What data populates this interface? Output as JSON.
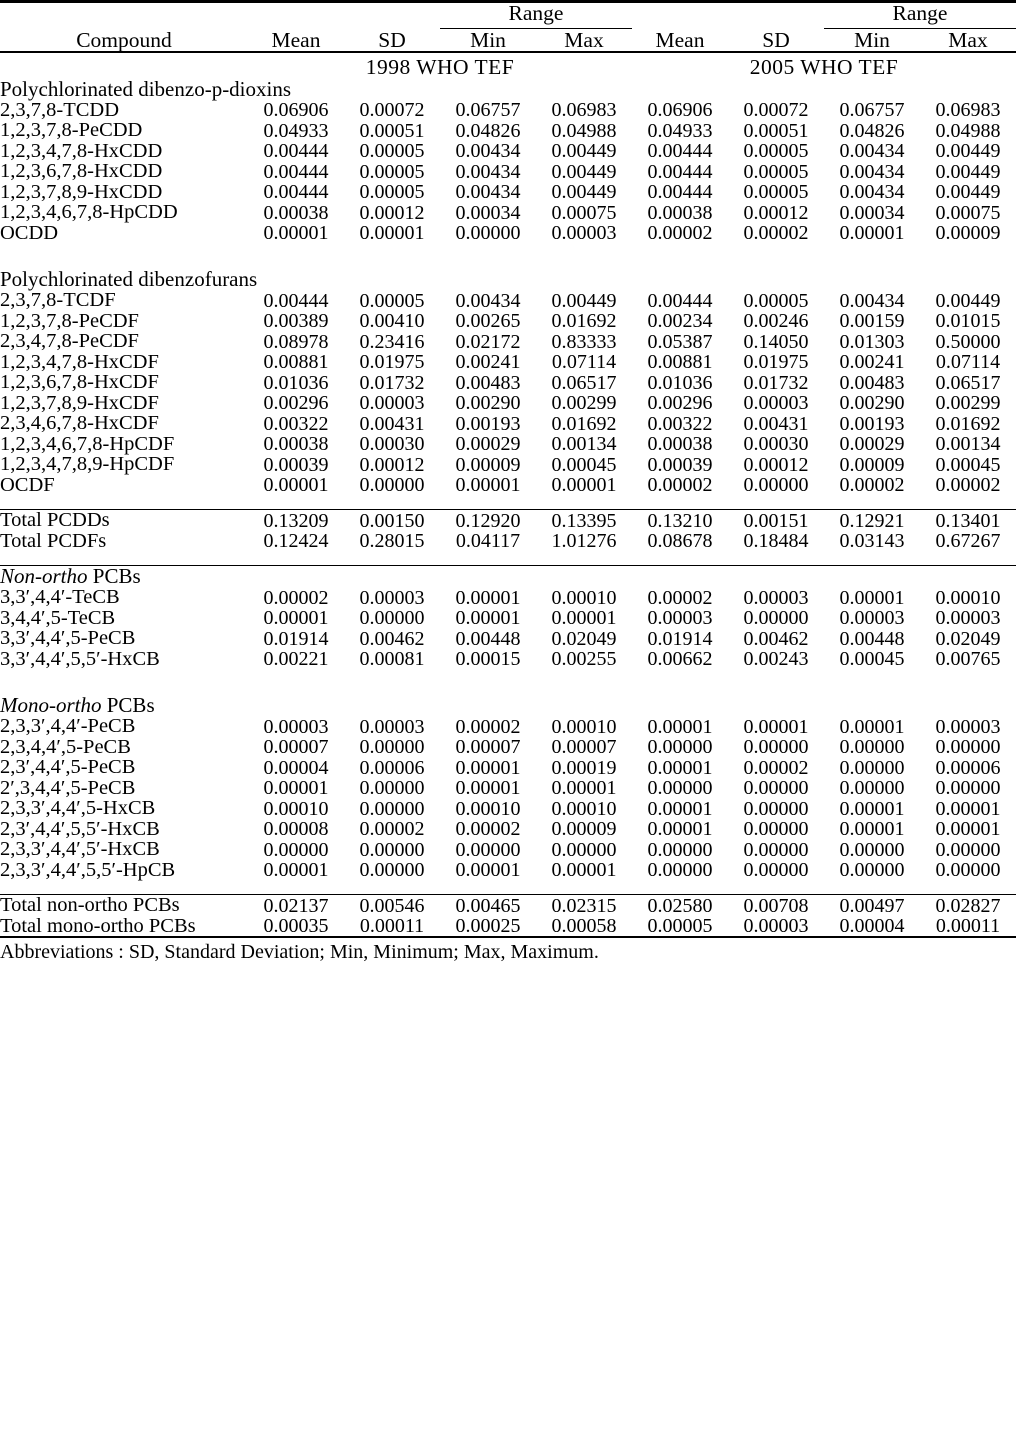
{
  "table": {
    "header": {
      "compound_label": "Compound",
      "mean_label": "Mean",
      "sd_label": "SD",
      "range_label": "Range",
      "min_label": "Min",
      "max_label": "Max"
    },
    "group_headers": {
      "tef_1998": "1998  WHO  TEF",
      "tef_2005": "2005  WHO  TEF"
    },
    "sections": [
      {
        "id": "pcdd",
        "title": "Polychlorinated dibenzo-p-dioxins",
        "title_style": "plain-italic-p",
        "rows": [
          {
            "compound": "2,3,7,8-TCDD",
            "v": [
              "0.06906",
              "0.00072",
              "0.06757",
              "0.06983",
              "0.06906",
              "0.00072",
              "0.06757",
              "0.06983"
            ]
          },
          {
            "compound": "1,2,3,7,8-PeCDD",
            "v": [
              "0.04933",
              "0.00051",
              "0.04826",
              "0.04988",
              "0.04933",
              "0.00051",
              "0.04826",
              "0.04988"
            ]
          },
          {
            "compound": "1,2,3,4,7,8-HxCDD",
            "v": [
              "0.00444",
              "0.00005",
              "0.00434",
              "0.00449",
              "0.00444",
              "0.00005",
              "0.00434",
              "0.00449"
            ]
          },
          {
            "compound": "1,2,3,6,7,8-HxCDD",
            "v": [
              "0.00444",
              "0.00005",
              "0.00434",
              "0.00449",
              "0.00444",
              "0.00005",
              "0.00434",
              "0.00449"
            ]
          },
          {
            "compound": "1,2,3,7,8,9-HxCDD",
            "v": [
              "0.00444",
              "0.00005",
              "0.00434",
              "0.00449",
              "0.00444",
              "0.00005",
              "0.00434",
              "0.00449"
            ]
          },
          {
            "compound": "1,2,3,4,6,7,8-HpCDD",
            "v": [
              "0.00038",
              "0.00012",
              "0.00034",
              "0.00075",
              "0.00038",
              "0.00012",
              "0.00034",
              "0.00075"
            ]
          },
          {
            "compound": "OCDD",
            "v": [
              "0.00001",
              "0.00001",
              "0.00000",
              "0.00003",
              "0.00002",
              "0.00002",
              "0.00001",
              "0.00009"
            ]
          }
        ]
      },
      {
        "id": "pcdf",
        "title": "Polychlorinated dibenzofurans",
        "title_style": "plain",
        "rows": [
          {
            "compound": "2,3,7,8-TCDF",
            "v": [
              "0.00444",
              "0.00005",
              "0.00434",
              "0.00449",
              "0.00444",
              "0.00005",
              "0.00434",
              "0.00449"
            ]
          },
          {
            "compound": "1,2,3,7,8-PeCDF",
            "v": [
              "0.00389",
              "0.00410",
              "0.00265",
              "0.01692",
              "0.00234",
              "0.00246",
              "0.00159",
              "0.01015"
            ]
          },
          {
            "compound": "2,3,4,7,8-PeCDF",
            "v": [
              "0.08978",
              "0.23416",
              "0.02172",
              "0.83333",
              "0.05387",
              "0.14050",
              "0.01303",
              "0.50000"
            ]
          },
          {
            "compound": "1,2,3,4,7,8-HxCDF",
            "v": [
              "0.00881",
              "0.01975",
              "0.00241",
              "0.07114",
              "0.00881",
              "0.01975",
              "0.00241",
              "0.07114"
            ]
          },
          {
            "compound": "1,2,3,6,7,8-HxCDF",
            "v": [
              "0.01036",
              "0.01732",
              "0.00483",
              "0.06517",
              "0.01036",
              "0.01732",
              "0.00483",
              "0.06517"
            ]
          },
          {
            "compound": "1,2,3,7,8,9-HxCDF",
            "v": [
              "0.00296",
              "0.00003",
              "0.00290",
              "0.00299",
              "0.00296",
              "0.00003",
              "0.00290",
              "0.00299"
            ]
          },
          {
            "compound": "2,3,4,6,7,8-HxCDF",
            "v": [
              "0.00322",
              "0.00431",
              "0.00193",
              "0.01692",
              "0.00322",
              "0.00431",
              "0.00193",
              "0.01692"
            ]
          },
          {
            "compound": "1,2,3,4,6,7,8-HpCDF",
            "v": [
              "0.00038",
              "0.00030",
              "0.00029",
              "0.00134",
              "0.00038",
              "0.00030",
              "0.00029",
              "0.00134"
            ]
          },
          {
            "compound": "1,2,3,4,7,8,9-HpCDF",
            "v": [
              "0.00039",
              "0.00012",
              "0.00009",
              "0.00045",
              "0.00039",
              "0.00012",
              "0.00009",
              "0.00045"
            ]
          },
          {
            "compound": "OCDF",
            "v": [
              "0.00001",
              "0.00000",
              "0.00001",
              "0.00001",
              "0.00002",
              "0.00000",
              "0.00002",
              "0.00002"
            ]
          }
        ]
      }
    ],
    "totals_pcdd_pcdf": [
      {
        "compound": "Total PCDDs",
        "v": [
          "0.13209",
          "0.00150",
          "0.12920",
          "0.13395",
          "0.13210",
          "0.00151",
          "0.12921",
          "0.13401"
        ]
      },
      {
        "compound": "Total PCDFs",
        "v": [
          "0.12424",
          "0.28015",
          "0.04117",
          "1.01276",
          "0.08678",
          "0.18484",
          "0.03143",
          "0.67267"
        ]
      }
    ],
    "pcb_sections": [
      {
        "id": "non-ortho",
        "title_italic": "Non-ortho",
        "title_rest": " PCBs",
        "rows": [
          {
            "compound": "3,3′,4,4′-TeCB",
            "v": [
              "0.00002",
              "0.00003",
              "0.00001",
              "0.00010",
              "0.00002",
              "0.00003",
              "0.00001",
              "0.00010"
            ]
          },
          {
            "compound": "3,4,4′,5-TeCB",
            "v": [
              "0.00001",
              "0.00000",
              "0.00001",
              "0.00001",
              "0.00003",
              "0.00000",
              "0.00003",
              "0.00003"
            ]
          },
          {
            "compound": "3,3′,4,4′,5-PeCB",
            "v": [
              "0.01914",
              "0.00462",
              "0.00448",
              "0.02049",
              "0.01914",
              "0.00462",
              "0.00448",
              "0.02049"
            ]
          },
          {
            "compound": "3,3′,4,4′,5,5′-HxCB",
            "v": [
              "0.00221",
              "0.00081",
              "0.00015",
              "0.00255",
              "0.00662",
              "0.00243",
              "0.00045",
              "0.00765"
            ]
          }
        ]
      },
      {
        "id": "mono-ortho",
        "title_italic": "Mono-ortho",
        "title_rest": " PCBs",
        "rows": [
          {
            "compound": "2,3,3′,4,4′-PeCB",
            "v": [
              "0.00003",
              "0.00003",
              "0.00002",
              "0.00010",
              "0.00001",
              "0.00001",
              "0.00001",
              "0.00003"
            ]
          },
          {
            "compound": "2,3,4,4′,5-PeCB",
            "v": [
              "0.00007",
              "0.00000",
              "0.00007",
              "0.00007",
              "0.00000",
              "0.00000",
              "0.00000",
              "0.00000"
            ]
          },
          {
            "compound": "2,3′,4,4′,5-PeCB",
            "v": [
              "0.00004",
              "0.00006",
              "0.00001",
              "0.00019",
              "0.00001",
              "0.00002",
              "0.00000",
              "0.00006"
            ]
          },
          {
            "compound": "2′,3,4,4′,5-PeCB",
            "v": [
              "0.00001",
              "0.00000",
              "0.00001",
              "0.00001",
              "0.00000",
              "0.00000",
              "0.00000",
              "0.00000"
            ]
          },
          {
            "compound": "2,3,3′,4,4′,5-HxCB",
            "v": [
              "0.00010",
              "0.00000",
              "0.00010",
              "0.00010",
              "0.00001",
              "0.00000",
              "0.00001",
              "0.00001"
            ]
          },
          {
            "compound": "2,3′,4,4′,5,5′-HxCB",
            "v": [
              "0.00008",
              "0.00002",
              "0.00002",
              "0.00009",
              "0.00001",
              "0.00000",
              "0.00001",
              "0.00001"
            ]
          },
          {
            "compound": "2,3,3′,4,4′,5′-HxCB",
            "v": [
              "0.00000",
              "0.00000",
              "0.00000",
              "0.00000",
              "0.00000",
              "0.00000",
              "0.00000",
              "0.00000"
            ]
          },
          {
            "compound": "2,3,3′,4,4′,5,5′-HpCB",
            "v": [
              "0.00001",
              "0.00000",
              "0.00001",
              "0.00001",
              "0.00000",
              "0.00000",
              "0.00000",
              "0.00000"
            ]
          }
        ]
      }
    ],
    "totals_pcb": [
      {
        "compound": "Total non-ortho PCBs",
        "v": [
          "0.02137",
          "0.00546",
          "0.00465",
          "0.02315",
          "0.02580",
          "0.00708",
          "0.00497",
          "0.02827"
        ]
      },
      {
        "compound": "Total mono-ortho PCBs",
        "v": [
          "0.00035",
          "0.00011",
          "0.00025",
          "0.00058",
          "0.00005",
          "0.00003",
          "0.00004",
          "0.00011"
        ]
      }
    ],
    "footnote": "Abbreviations : SD, Standard Deviation; Min, Minimum; Max, Maximum."
  }
}
